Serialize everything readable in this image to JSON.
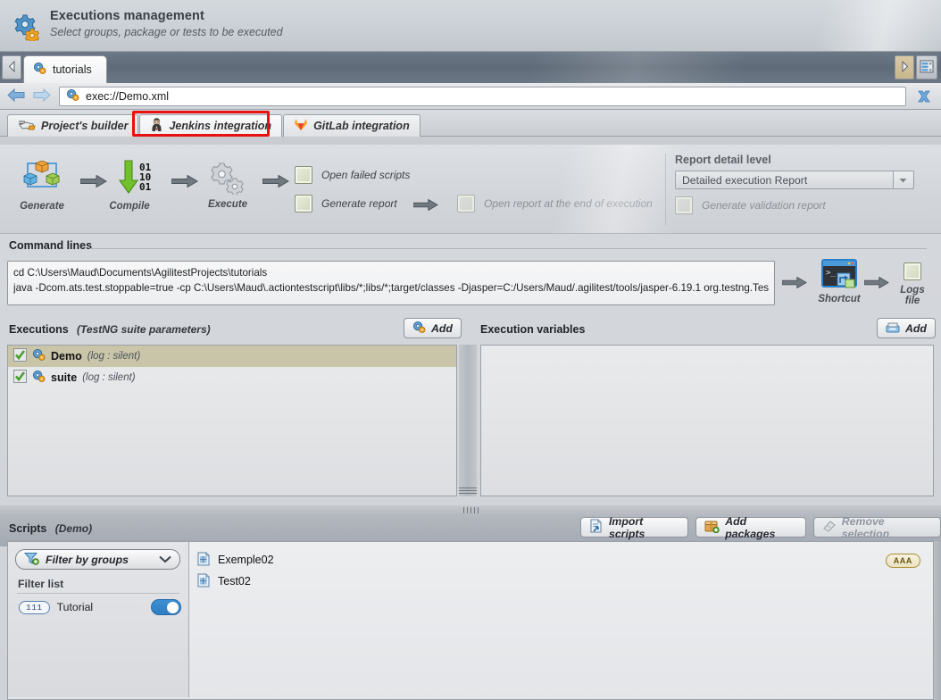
{
  "header": {
    "icon": "gears-icon",
    "title": "Executions management",
    "subtitle": "Select groups, package or tests to be executed"
  },
  "tabstrip": {
    "scroll_left_icon": "chevron-left-icon",
    "scroll_right_icon": "chevron-right-icon",
    "list_icon": "tab-list-icon",
    "tabs": [
      {
        "label": "tutorials",
        "icon": "gears-icon",
        "active": true
      }
    ]
  },
  "urlbar": {
    "back_icon": "arrow-left-icon",
    "forward_icon": "arrow-right-icon",
    "file_icon": "gears-icon",
    "value": "exec://Demo.xml",
    "placeholder": "exec://Demo.xml",
    "close_icon": "close-x-icon"
  },
  "integration_tabs": [
    {
      "label": "Project's builder",
      "icon": "builder-icon",
      "active": false,
      "highlighted": false
    },
    {
      "label": "Jenkins integration",
      "icon": "jenkins-butler-icon",
      "active": true,
      "highlighted": true
    },
    {
      "label": "GitLab integration",
      "icon": "gitlab-fox-icon",
      "active": false,
      "highlighted": false
    }
  ],
  "highlight_color": "#e81010",
  "workflow": {
    "steps": [
      {
        "label": "Generate",
        "icon": "package-cubes-icon"
      },
      {
        "label": "Compile",
        "icon": "binary-download-icon"
      },
      {
        "label": "Execute",
        "icon": "cogs-icon"
      }
    ],
    "arrow_icon": "arrow-right-thick-icon",
    "options": [
      {
        "label": "Open failed scripts",
        "checked": false,
        "disabled": false,
        "icon": "checkbox-icon"
      },
      {
        "label": "Generate report",
        "checked": false,
        "disabled": false,
        "icon": "checkbox-icon"
      },
      {
        "label": "Open  report at the end of execution",
        "checked": false,
        "disabled": true,
        "icon": "checkbox-icon"
      }
    ]
  },
  "report": {
    "title": "Report detail level",
    "select_value": "Detailed execution Report",
    "select_arrow_icon": "chevron-down-icon",
    "validation_label": "Generate validation report",
    "validation_checked": false,
    "validation_disabled": true
  },
  "command_lines": {
    "title": "Command lines",
    "lines": [
      "cd C:\\Users\\Maud\\Documents\\AgilitestProjects\\tutorials",
      "java -Dcom.ats.test.stoppable=true -cp C:\\Users\\Maud\\.actiontestscript\\libs/*;libs/*;target/classes -Djasper=C:/Users/Maud/.agilitest/tools/jasper-6.19.1 org.testng.TestNG src/exec"
    ],
    "shortcut_label": "Shortcut",
    "shortcut_icon": "console-shortcut-icon",
    "logs_label": "Logs file",
    "logs_icon": "checkbox-icon",
    "arrow_icon": "arrow-right-thick-icon"
  },
  "executions": {
    "title": "Executions",
    "subtitle": "(TestNG suite parameters)",
    "add_label": "Add",
    "add_icon": "gears-icon",
    "rows": [
      {
        "name": "Demo",
        "meta": "(log : silent)",
        "checked": true,
        "selected": true,
        "icon": "gears-icon"
      },
      {
        "name": "suite",
        "meta": "(log : silent)",
        "checked": true,
        "selected": false,
        "icon": "gears-icon"
      }
    ]
  },
  "execution_variables": {
    "title": "Execution variables",
    "add_label": "Add",
    "add_icon": "drawer-icon",
    "rows": []
  },
  "scripts": {
    "title": "Scripts",
    "subtitle": "(Demo)",
    "buttons": [
      {
        "label": "Import scripts",
        "icon": "import-scripts-icon",
        "disabled": false
      },
      {
        "label": "Add packages",
        "icon": "package-add-icon",
        "disabled": false
      },
      {
        "label": "Remove selection",
        "icon": "eraser-icon",
        "disabled": true
      }
    ],
    "filter": {
      "button_label": "Filter by groups",
      "button_icon": "funnel-add-icon",
      "chevron_icon": "chevron-down-icon",
      "list_label": "Filter list",
      "items": [
        {
          "count": "111",
          "label": "Tutorial",
          "enabled": true
        }
      ]
    },
    "items": [
      {
        "name": "Exemple02",
        "icon": "script-file-icon"
      },
      {
        "name": "Test02",
        "icon": "script-file-icon"
      }
    ],
    "badge": "AAA"
  }
}
